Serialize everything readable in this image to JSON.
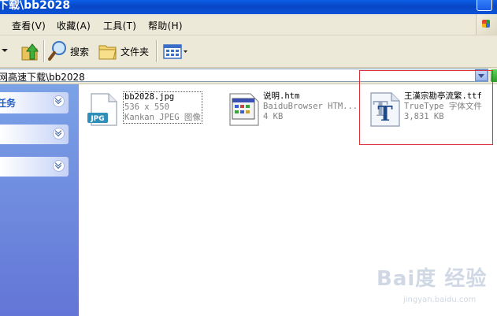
{
  "window": {
    "title": "下载\\bb2028"
  },
  "menu": {
    "items": [
      {
        "label": "查看(V)"
      },
      {
        "label": "收藏(A)"
      },
      {
        "label": "工具(T)"
      },
      {
        "label": "帮助(H)"
      }
    ]
  },
  "toolbar": {
    "search_label": "搜索",
    "folders_label": "文件夹"
  },
  "address": {
    "path": "网高速下载\\bb2028"
  },
  "taskpane": {
    "panels": [
      {
        "title": "任务"
      },
      {
        "title": ""
      },
      {
        "title": ""
      }
    ]
  },
  "files": [
    {
      "name": "bb2028.jpg",
      "type": "536 x 550",
      "size": "Kankan JPEG 图像",
      "icon": "jpg-file-icon",
      "badge": "JPG"
    },
    {
      "name": "说明.htm",
      "type": "BaiduBrowser HTM...",
      "size": "4 KB",
      "icon": "html-file-icon"
    },
    {
      "name": "王漢宗勘亭流繁.ttf",
      "type": "TrueType 字体文件",
      "size": "3,831 KB",
      "icon": "truetype-font-icon",
      "glyph": "T"
    }
  ],
  "watermark": {
    "brand": "Bai度 经验",
    "url": "jingyan.baidu.com"
  },
  "colors": {
    "titlebar": "#0a54d8",
    "taskpane": "#6f8fe0",
    "highlight": "#d9323a",
    "chrome": "#ece9d8"
  }
}
